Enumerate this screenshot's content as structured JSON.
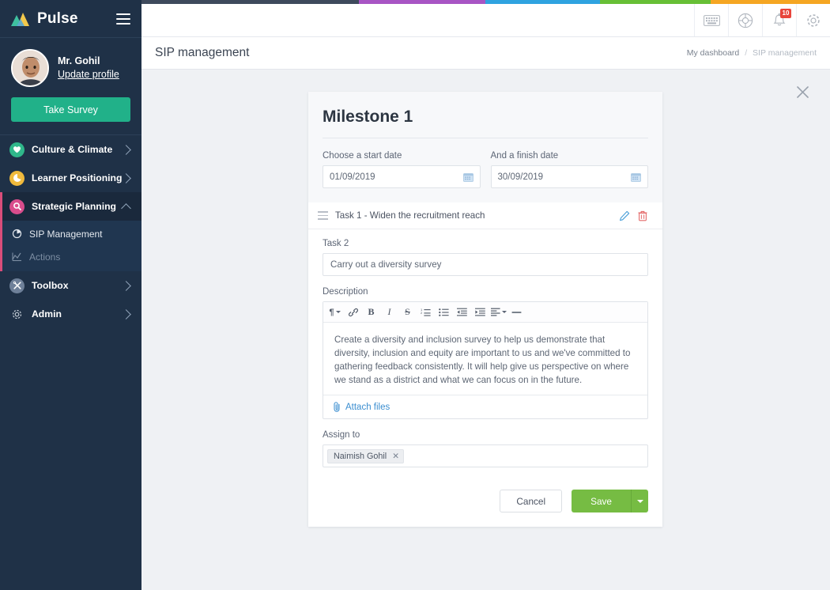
{
  "brand": {
    "name": "Pulse",
    "logo_icon": "mountains-logo",
    "menu_icon": "hamburger-icon"
  },
  "profile": {
    "name": "Mr. Gohil",
    "update_link": "Update profile",
    "survey_button": "Take Survey",
    "avatar_icon": "user-avatar"
  },
  "sidebar": {
    "items": [
      {
        "label": "Culture & Climate",
        "icon": "heart-circle-icon",
        "color": "#2fb78a",
        "expandable": true,
        "active": false
      },
      {
        "label": "Learner Positioning",
        "icon": "pie-circle-icon",
        "color": "#f0ba3c",
        "expandable": true,
        "active": false
      },
      {
        "label": "Strategic Planning",
        "icon": "search-circle-icon",
        "color": "#d94d8c",
        "expandable": true,
        "active": true
      }
    ],
    "subitems": [
      {
        "label": "SIP Management",
        "icon": "pie-chart-icon",
        "active": true
      },
      {
        "label": "Actions",
        "icon": "bar-chart-icon",
        "active": false
      }
    ],
    "items_lower": [
      {
        "label": "Toolbox",
        "icon": "tools-circle-icon",
        "color": "#6e8099",
        "expandable": true
      },
      {
        "label": "Admin",
        "icon": "gear-icon",
        "color": "transparent",
        "expandable": true
      }
    ]
  },
  "topstrip": {
    "colors": [
      "#3e4a5c",
      "#a855c4",
      "#2fa3e0",
      "#67bf36",
      "#f5a623"
    ]
  },
  "topbar": {
    "icons": [
      {
        "name": "keyboard-icon",
        "badge": null
      },
      {
        "name": "lifebuoy-icon",
        "badge": null
      },
      {
        "name": "bell-icon",
        "badge": "10"
      },
      {
        "name": "settings-gear-icon",
        "badge": null
      }
    ],
    "badge_color": "#e8453c"
  },
  "page": {
    "title": "SIP management",
    "breadcrumb": {
      "parent": "My dashboard",
      "separator": "/",
      "current": "SIP management"
    },
    "close_icon": "close-icon"
  },
  "milestone": {
    "title": "Milestone 1",
    "start_label": "Choose a start date",
    "start_value": "01/09/2019",
    "finish_label": "And a finish date",
    "finish_value": "30/09/2019",
    "calendar_icon": "calendar-icon"
  },
  "tasks": [
    {
      "name": "Task 1 - Widen the recruitment reach",
      "drag_icon": "drag-handle-icon",
      "edit_icon": "pencil-icon",
      "delete_icon": "trash-icon"
    }
  ],
  "task_form": {
    "task_label": "Task 2",
    "task_value": "Carry out a diversity survey",
    "task_placeholder": "Carry out a diversity survey",
    "description_label": "Description",
    "description_text": "Create a diversity and inclusion survey to help us demonstrate that diversity, inclusion and equity are important to us and we've committed to gathering feedback consistently. It will help give us perspective on where we stand as a district and what we can focus on in the future.",
    "attach_label": "Attach files",
    "attach_icon": "paperclip-icon",
    "assign_label": "Assign to",
    "assignees": [
      {
        "name": "Naimish Gohil",
        "remove_icon": "chip-remove-icon"
      }
    ],
    "toolbar": [
      {
        "name": "paragraph-format-dropdown",
        "glyph": "¶",
        "caret": true
      },
      {
        "name": "link-icon",
        "glyph": "link",
        "caret": false
      },
      {
        "name": "bold-icon",
        "glyph": "B",
        "caret": false
      },
      {
        "name": "italic-icon",
        "glyph": "I",
        "caret": false
      },
      {
        "name": "strikethrough-icon",
        "glyph": "S",
        "caret": false
      },
      {
        "name": "ordered-list-icon",
        "glyph": "ol",
        "caret": false
      },
      {
        "name": "unordered-list-icon",
        "glyph": "ul",
        "caret": false
      },
      {
        "name": "outdent-icon",
        "glyph": "outdent",
        "caret": false
      },
      {
        "name": "indent-icon",
        "glyph": "indent",
        "caret": false
      },
      {
        "name": "align-dropdown",
        "glyph": "align",
        "caret": true
      },
      {
        "name": "horizontal-rule-icon",
        "glyph": "hr",
        "caret": false
      }
    ],
    "cancel_label": "Cancel",
    "save_label": "Save",
    "save_color": "#76bc43"
  }
}
